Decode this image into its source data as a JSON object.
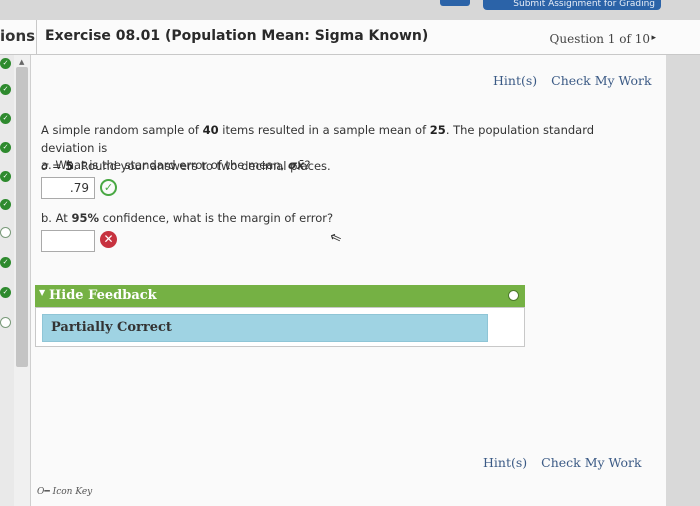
{
  "header": {
    "left_fragment": "ions",
    "title": "Exercise 08.01 (Population Mean: Sigma Known)",
    "question_counter": "Question 1 of 10",
    "next_arrow": "▸"
  },
  "top_button_label": "Submit Assignment for Grading",
  "toolbar_top": {
    "hint_label": "Hint(s)",
    "check_label": "Check My Work"
  },
  "problem": {
    "text_1": "A simple random sample of ",
    "n": "40",
    "text_2": " items resulted in a sample mean of ",
    "mean": "25",
    "text_3": ". The population standard deviation is",
    "sigma_sym": "σ = ",
    "sigma": "5",
    "text_4": ". Round your answers to two decimal places."
  },
  "part_a": {
    "prefix": "a. What is the standard error of the mean, ",
    "symbol": "σx̄",
    "suffix": "?",
    "answer": ".79",
    "status": "correct"
  },
  "part_b": {
    "prefix": "b. At ",
    "confidence": "95%",
    "suffix": " confidence, what is the margin of error?",
    "answer": "",
    "status": "incorrect"
  },
  "feedback": {
    "toggle_label": "Hide Feedback",
    "result": "Partially Correct"
  },
  "toolbar_bottom": {
    "hint_label": "Hint(s)",
    "check_label": "Check My Work"
  },
  "footer": {
    "icon_key_label": "Icon Key"
  },
  "sidebar_status": [
    "done",
    "done",
    "done",
    "done",
    "done",
    "done",
    "open",
    "done",
    "done",
    "open"
  ],
  "colors": {
    "accent_blue": "#2b63a8",
    "feedback_green": "#75b144",
    "feedback_blue": "#9fd3e3",
    "correct_green": "#49a843",
    "error_red": "#c7323f",
    "link": "#3b5a85"
  },
  "icons": {
    "correct": "check-circle-icon",
    "incorrect": "x-circle-icon",
    "key": "key-icon"
  }
}
